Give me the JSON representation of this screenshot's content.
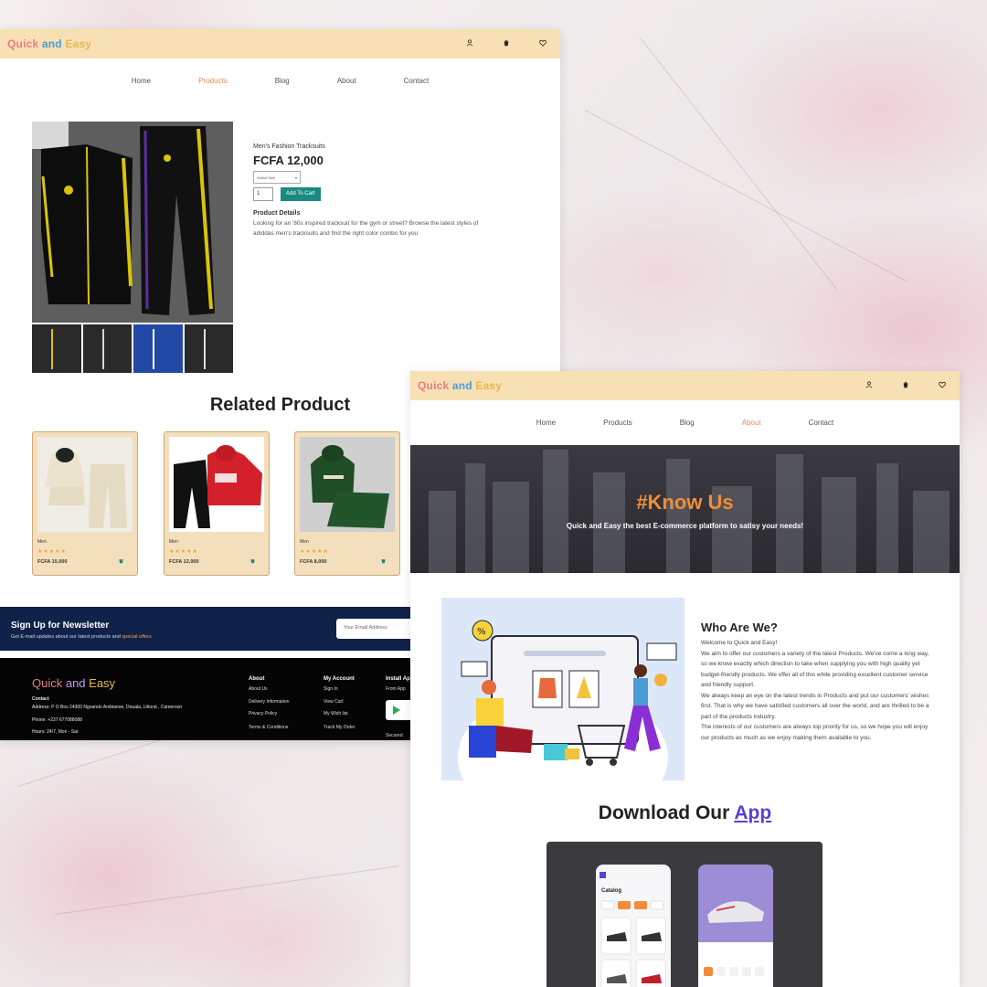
{
  "product_window": {
    "brand": [
      "Quick ",
      "and ",
      "Easy"
    ],
    "icons": [
      "user-icon",
      "cart-icon",
      "heart-icon"
    ],
    "nav": [
      {
        "label": "Home",
        "active": false
      },
      {
        "label": "Products",
        "active": true
      },
      {
        "label": "Blog",
        "active": false
      },
      {
        "label": "About",
        "active": false
      },
      {
        "label": "Contact",
        "active": false
      }
    ],
    "product": {
      "name": "Men's Fashion Tracksuits",
      "price": "FCFA 12,000",
      "size_select": "Select Size",
      "quantity": "1",
      "add_to_cart": "Add To Cart",
      "details_title": "Product Details",
      "details_text": "Looking for an '80s inspired tracksuit for the gym or street? Browse the latest styles of adiddas men's tracksuits and find the right color combo for you"
    },
    "related_title": "Related Product",
    "related": [
      {
        "category": "Men",
        "stars": "★★★★★",
        "price": "FCFA 15,000"
      },
      {
        "category": "Men",
        "stars": "★★★★★",
        "price": "FCFA 12,000"
      },
      {
        "category": "Men",
        "stars": "★★★★★",
        "price": "FCFA 8,000"
      }
    ],
    "newsletter": {
      "title": "Sign Up for Newsletter",
      "sub_prefix": "Get E-mail updates about our latest products and ",
      "sub_highlight": "special offers",
      "placeholder": "Your Email Address"
    },
    "footer": {
      "brand": [
        "Quick ",
        "and ",
        "Easy"
      ],
      "contact_head": "Contact",
      "address": "Address: P O Box 24300 Ngoando Ambianoe, Douala, Littoral , Cameroon",
      "phone": "Phone: +237 677088088",
      "hours": "Hours: 24/7, Mon - Sat",
      "about_head": "About",
      "about_links": [
        "About Us",
        "Delivery Information",
        "Privacy Policy",
        "Terms & Conditions"
      ],
      "account_head": "My Account",
      "account_links": [
        "Sign In",
        "View Cart",
        "My Wish list",
        "Track My Order"
      ],
      "install_head": "Install App",
      "install_sub": "From App",
      "secured": "Secured"
    }
  },
  "about_window": {
    "brand": [
      "Quick ",
      "and ",
      "Easy"
    ],
    "icons": [
      "user-icon",
      "cart-icon",
      "heart-icon"
    ],
    "nav": [
      {
        "label": "Home",
        "active": false
      },
      {
        "label": "Products",
        "active": false
      },
      {
        "label": "Blog",
        "active": false
      },
      {
        "label": "About",
        "active": true
      },
      {
        "label": "Contact",
        "active": false
      }
    ],
    "hero_title": "#Know Us",
    "hero_sub": "Quick and Easy the best E-commerce platform to satisy your needs!",
    "who_title": "Who Are We?",
    "who_lines": [
      "Welcome to Quick and Easy!",
      "We aim to offer our customers a variety of the latest Products. We've come a long way, so we know exactly which direction to take when supplying you with high quality yet budget-friendly products. We offer all of this while providing excellent customer service and friendly support.",
      "We always keep an eye on the latest trends in Products and put our customers' wishes first. That is why we have satisfied customers all over the world, and are thrilled to be a part of the products industry.",
      "The interests of our customers are always top priority for us, so we hope you will enjoy our products as much as we enjoy making them available to you."
    ],
    "download_prefix": "Download Our ",
    "download_app": "App",
    "app_catalog_label": "Catalog"
  },
  "colors": {
    "topbar": "#f8e0b5",
    "accent_orange": "#e88a60",
    "teal": "#1a8a80",
    "navy": "#10224a",
    "purple": "#5b3fd6"
  }
}
